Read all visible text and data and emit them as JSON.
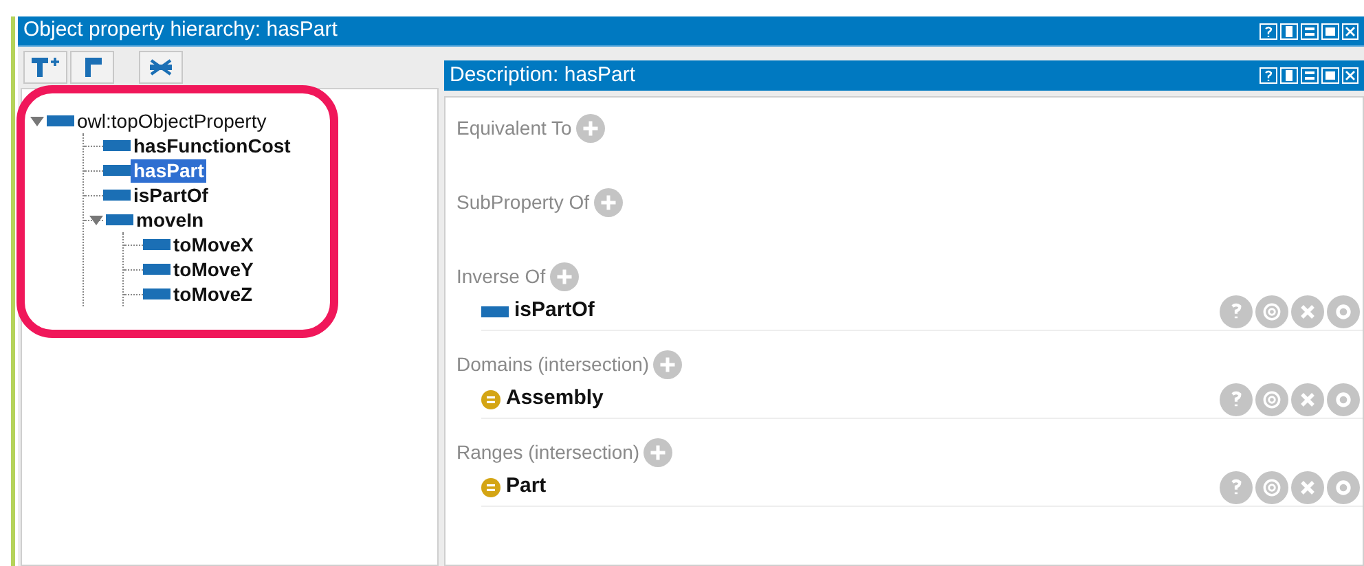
{
  "hierarchy_view": {
    "title": "Object property hierarchy: hasPart",
    "tree": [
      {
        "label": "owl:topObjectProperty",
        "selected": false,
        "expanded": true,
        "children": [
          {
            "label": "hasFunctionCost",
            "selected": false
          },
          {
            "label": "hasPart",
            "selected": true
          },
          {
            "label": "isPartOf",
            "selected": false
          },
          {
            "label": "moveIn",
            "selected": false,
            "expanded": true,
            "children": [
              {
                "label": "toMoveX",
                "selected": false
              },
              {
                "label": "toMoveY",
                "selected": false
              },
              {
                "label": "toMoveZ",
                "selected": false
              }
            ]
          }
        ]
      }
    ]
  },
  "description_view": {
    "title": "Description: hasPart",
    "sections": [
      {
        "label": "Equivalent To"
      },
      {
        "label": "SubProperty Of"
      },
      {
        "label": "Inverse Of",
        "items": [
          {
            "name": "isPartOf",
            "kind": "property"
          }
        ]
      },
      {
        "label": "Domains (intersection)",
        "items": [
          {
            "name": "Assembly",
            "kind": "class"
          }
        ]
      },
      {
        "label": "Ranges (intersection)",
        "items": [
          {
            "name": "Part",
            "kind": "class"
          }
        ]
      }
    ]
  }
}
